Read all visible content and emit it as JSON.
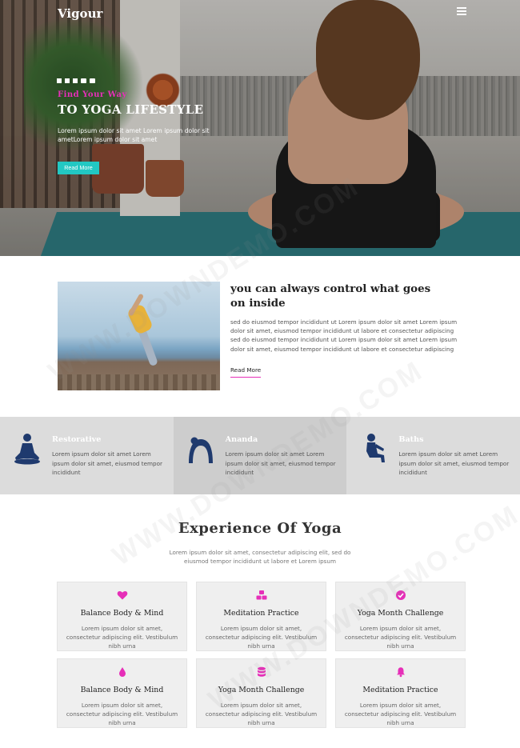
{
  "header": {
    "logo": "Vigour",
    "menu_icon": "hamburger-menu-icon"
  },
  "hero": {
    "social_icons": [
      "facebook-icon",
      "twitter-icon",
      "rss-icon",
      "youtube-icon",
      "instagram-icon"
    ],
    "kicker": "Find Your Way",
    "title": "TO YOGA LIFESTYLE",
    "text": "Lorem ipsum dolor sit amet Lorem ipsum dolor sit ametLorem ipsum dolor sit amet",
    "button_label": "Read More",
    "button_color": "#22c8c3",
    "accent_color": "#e62fb8"
  },
  "about": {
    "title": "you can always control what goes on inside",
    "text": "sed do eiusmod tempor incididunt ut Lorem ipsum dolor sit amet Lorem ipsum dolor sit amet, eiusmod tempor incididunt ut labore et consectetur adipiscing sed do eiusmod tempor incididunt ut Lorem ipsum dolor sit amet Lorem ipsum dolor sit amet, eiusmod tempor incididunt ut labore et consectetur adipiscing",
    "link_label": "Read More"
  },
  "features": [
    {
      "title": "Restorative",
      "text": "Lorem ipsum dolor sit amet Lorem ipsum dolor sit amet, eiusmod tempor incididunt",
      "icon": "meditation-pose-icon"
    },
    {
      "title": "Ananda",
      "text": "Lorem ipsum dolor sit amet Lorem ipsum dolor sit amet, eiusmod tempor incididunt",
      "icon": "backbend-pose-icon"
    },
    {
      "title": "Baths",
      "text": "Lorem ipsum dolor sit amet Lorem ipsum dolor sit amet, eiusmod tempor incididunt",
      "icon": "seated-pose-icon"
    }
  ],
  "experience": {
    "title": "Experience Of Yoga",
    "subtitle": "Lorem ipsum dolor sit amet, consectetur adipiscing elit, sed do eiusmod tempor incididunt ut labore et Lorem ipsum",
    "cards": [
      {
        "title": "Balance Body & Mind",
        "text": "Lorem ipsum dolor sit amet, consectetur adipiscing elit. Vestibulum nibh urna",
        "icon": "heart-icon"
      },
      {
        "title": "Meditation Practice",
        "text": "Lorem ipsum dolor sit amet, consectetur adipiscing elit. Vestibulum nibh urna",
        "icon": "cubes-icon"
      },
      {
        "title": "Yoga Month Challenge",
        "text": "Lorem ipsum dolor sit amet, consectetur adipiscing elit. Vestibulum nibh urna",
        "icon": "check-circle-icon"
      },
      {
        "title": "Balance Body & Mind",
        "text": "Lorem ipsum dolor sit amet, consectetur adipiscing elit. Vestibulum nibh urna",
        "icon": "drop-icon"
      },
      {
        "title": "Yoga Month Challenge",
        "text": "Lorem ipsum dolor sit amet, consectetur adipiscing elit. Vestibulum nibh urna",
        "icon": "database-icon"
      },
      {
        "title": "Meditation Practice",
        "text": "Lorem ipsum dolor sit amet, consectetur adipiscing elit. Vestibulum nibh urna",
        "icon": "bell-icon"
      }
    ]
  },
  "watermark": "WWW.DOWNDEMO.COM"
}
